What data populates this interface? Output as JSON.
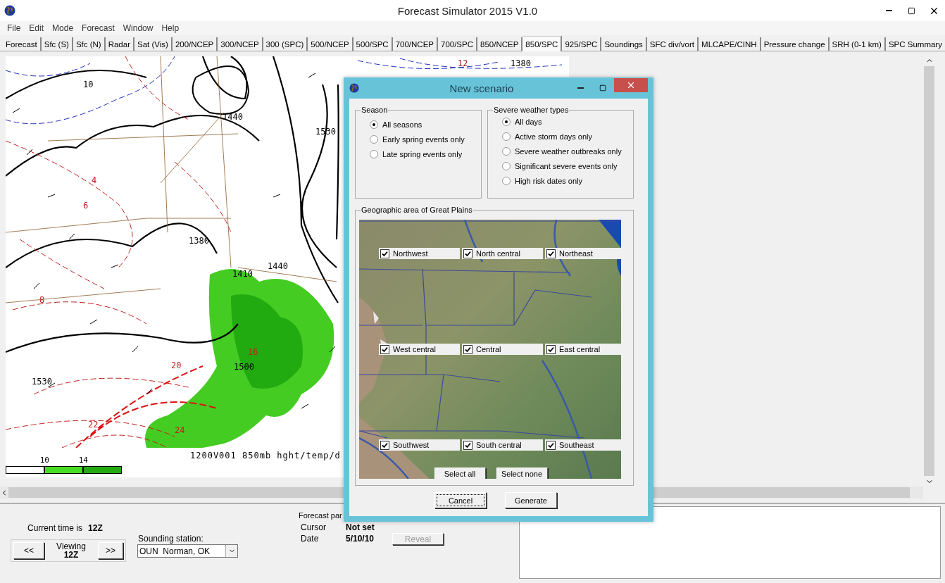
{
  "window": {
    "title": "Forecast Simulator 2015 V1.0"
  },
  "menu": [
    "File",
    "Edit",
    "Mode",
    "Forecast",
    "Window",
    "Help"
  ],
  "tabs": [
    {
      "label": "Forecast",
      "selected": false
    },
    {
      "label": "Sfc (S)",
      "selected": false
    },
    {
      "label": "Sfc (N)",
      "selected": false
    },
    {
      "label": "Radar",
      "selected": false
    },
    {
      "label": "Sat (Vis)",
      "selected": false
    },
    {
      "label": "200/NCEP",
      "selected": false
    },
    {
      "label": "300/NCEP",
      "selected": false
    },
    {
      "label": "300 (SPC)",
      "selected": false
    },
    {
      "label": "500/NCEP",
      "selected": false
    },
    {
      "label": "500/SPC",
      "selected": false
    },
    {
      "label": "700/NCEP",
      "selected": false
    },
    {
      "label": "700/SPC",
      "selected": false
    },
    {
      "label": "850/NCEP",
      "selected": false
    },
    {
      "label": "850/SPC",
      "selected": true
    },
    {
      "label": "925/SPC",
      "selected": false
    },
    {
      "label": "Soundings",
      "selected": false
    },
    {
      "label": "SFC div/vort",
      "selected": false
    },
    {
      "label": "MLCAPE/CINH",
      "selected": false
    },
    {
      "label": "Pressure change",
      "selected": false
    },
    {
      "label": "SRH (0-1 km)",
      "selected": false
    },
    {
      "label": "SPC Summary",
      "selected": false
    }
  ],
  "map": {
    "contour_labels": [
      "1440",
      "1530",
      "1380",
      "1410",
      "1440",
      "1500",
      "1530",
      "1380",
      "12",
      "20",
      "22",
      "24",
      "4",
      "6",
      "8",
      "16",
      "10"
    ],
    "caption": "1200V001 850mb hght/temp/d",
    "legend": [
      "10",
      "14"
    ]
  },
  "dialog": {
    "title": "New scenario",
    "season": {
      "title": "Season",
      "options": [
        {
          "label": "All seasons",
          "selected": true
        },
        {
          "label": "Early spring events only",
          "selected": false
        },
        {
          "label": "Late spring events only",
          "selected": false
        }
      ]
    },
    "severe": {
      "title": "Severe weather types",
      "options": [
        {
          "label": "All days",
          "selected": true
        },
        {
          "label": "Active storm days only",
          "selected": false
        },
        {
          "label": "Severe weather outbreaks only",
          "selected": false
        },
        {
          "label": "Significant severe events only",
          "selected": false
        },
        {
          "label": "High risk dates only",
          "selected": false
        }
      ]
    },
    "area": {
      "title": "Geographic area of Great Plains",
      "regions": [
        {
          "label": "Northwest",
          "checked": true
        },
        {
          "label": "North central",
          "checked": true
        },
        {
          "label": "Northeast",
          "checked": true
        },
        {
          "label": "West central",
          "checked": true
        },
        {
          "label": "Central",
          "checked": true
        },
        {
          "label": "East central",
          "checked": true
        },
        {
          "label": "Southwest",
          "checked": true
        },
        {
          "label": "South central",
          "checked": true
        },
        {
          "label": "Southeast",
          "checked": true
        }
      ],
      "buttons": [
        "Select all",
        "Select none"
      ]
    },
    "buttons": [
      {
        "label": "Cancel",
        "focused": true
      },
      {
        "label": "Generate",
        "focused": false
      }
    ]
  },
  "bottom": {
    "current_time_label": "Current time is",
    "current_time": "12Z",
    "prev": "<<",
    "viewing_label": "Viewing",
    "viewing_time": "12Z",
    "next": ">>",
    "sounding_label": "Sounding station:",
    "sounding_value": "OUN  Norman, OK",
    "forecast_label": "Forecast par",
    "cursor_label": "Cursor",
    "cursor_value": "Not set",
    "date_label": "Date",
    "date_value": "5/10/10",
    "reveal": {
      "label": "Reveal",
      "disabled": true
    }
  }
}
